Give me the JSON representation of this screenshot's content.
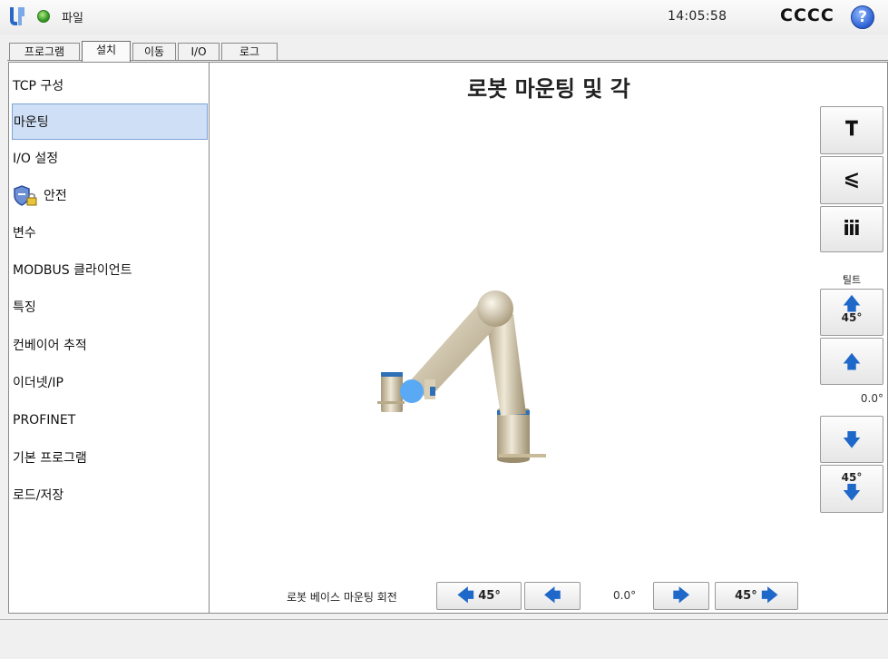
{
  "topbar": {
    "file_menu": "파일",
    "clock": "14:05:58",
    "robot_name": "CCCC",
    "help_symbol": "?",
    "status_color": "#3da12a"
  },
  "tabs": [
    {
      "label": "프로그램"
    },
    {
      "label": "설치",
      "active": true
    },
    {
      "label": "이동"
    },
    {
      "label": "I/O"
    },
    {
      "label": "로그"
    }
  ],
  "sidebar": {
    "items": [
      {
        "label": "TCP 구성"
      },
      {
        "label": "마운팅",
        "selected": true
      },
      {
        "label": "I/O 설정"
      },
      {
        "label": "안전",
        "icon": "safety-shield-lock-icon"
      },
      {
        "label": "변수"
      },
      {
        "label": "MODBUS 클라이언트"
      },
      {
        "label": "특징"
      },
      {
        "label": "컨베이어 추적"
      },
      {
        "label": "이더넷/IP"
      },
      {
        "label": "PROFINET"
      },
      {
        "label": "기본 프로그램"
      },
      {
        "label": "로드/저장"
      }
    ]
  },
  "main": {
    "title": "로봇 마운팅 및 각",
    "tilt": {
      "label": "틸트",
      "value": "0.0°",
      "up_45_label": "45°",
      "down_45_label": "45°"
    },
    "base_rotation": {
      "label": "로봇 베이스 마운팅 회전",
      "value": "0.0°",
      "left_45_label": "45°",
      "right_45_label": "45°"
    },
    "accent_color": "#1e68c9"
  }
}
